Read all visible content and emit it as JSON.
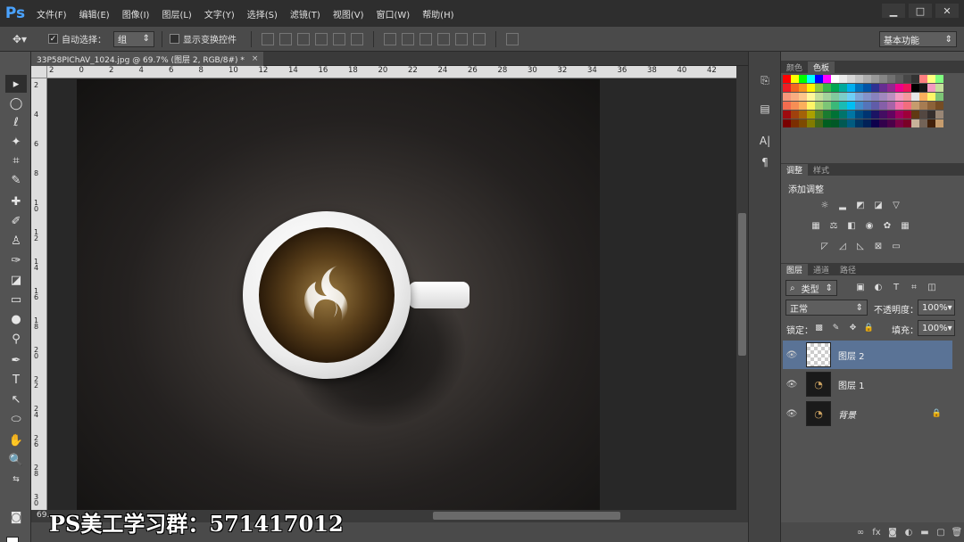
{
  "app": {
    "logo": "Ps"
  },
  "menu": [
    "文件(F)",
    "编辑(E)",
    "图像(I)",
    "图层(L)",
    "文字(Y)",
    "选择(S)",
    "滤镜(T)",
    "视图(V)",
    "窗口(W)",
    "帮助(H)"
  ],
  "window_buttons": {
    "minimize": "▁",
    "maximize": "□",
    "close": "✕"
  },
  "options": {
    "auto_select_label": "自动选择：",
    "auto_select_checked": "✓",
    "auto_select_value": "组",
    "transform_label": "显示变换控件",
    "workspace": "基本功能"
  },
  "document": {
    "tab_title": "33P58PIChAV_1024.jpg @ 69.7% (图层 2, RGB/8#) *",
    "tab_close": "×",
    "status_text": "69.",
    "watermark": "PS美工学习群：571417012"
  },
  "ruler": {
    "h": [
      "2",
      "0",
      "2",
      "4",
      "6",
      "8",
      "10",
      "12",
      "14",
      "16",
      "18",
      "20",
      "22",
      "24",
      "26",
      "28",
      "30",
      "32",
      "34",
      "36",
      "38",
      "40",
      "42"
    ],
    "v": [
      "2",
      "4",
      "6",
      "8",
      "10",
      "12",
      "14",
      "16",
      "18",
      "20",
      "22",
      "24",
      "26",
      "28",
      "30"
    ]
  },
  "panels": {
    "color_tabs": [
      "颜色",
      "色板"
    ],
    "adj_tabs": [
      "调整",
      "样式"
    ],
    "adj_title": "添加调整",
    "layers_tabs": [
      "图层",
      "通道",
      "路径"
    ],
    "kind_label": "类型",
    "blend_mode": "正常",
    "opacity_label": "不透明度：",
    "opacity_value": "100%",
    "lock_label": "锁定：",
    "fill_label": "填充：",
    "fill_value": "100%",
    "layers": [
      {
        "name": "图层 2",
        "selected": true
      },
      {
        "name": "图层 1",
        "selected": false
      },
      {
        "name": "背景",
        "selected": false
      }
    ]
  },
  "colors": {
    "accent": "#4aa3ff",
    "selection": "#5a7396"
  },
  "swatches": [
    [
      "#ff0000",
      "#ffff00",
      "#00ff00",
      "#00ffff",
      "#0000ff",
      "#ff00ff",
      "#ffffff",
      "#ebebeb",
      "#d6d6d6",
      "#c2c2c2",
      "#adadad",
      "#999999",
      "#858585",
      "#707070",
      "#5c5c5c",
      "#474747",
      "#333333",
      "#ff8080",
      "#ffff80",
      "#80ff80"
    ],
    [
      "#ee1d24",
      "#f26522",
      "#f7941d",
      "#fff200",
      "#8dc63f",
      "#39b54a",
      "#00a651",
      "#00a99d",
      "#00aeef",
      "#0072bc",
      "#0054a6",
      "#2e3192",
      "#662d91",
      "#92278f",
      "#ec008c",
      "#ed145b",
      "#000000",
      "#1a1a1a",
      "#f49ac1",
      "#c4df9b"
    ],
    [
      "#f7977a",
      "#f9ad81",
      "#fdc68a",
      "#fff79a",
      "#c4df9b",
      "#a3d39c",
      "#82ca9d",
      "#7bcdc8",
      "#6ecff6",
      "#7ea7d8",
      "#8493ca",
      "#8882be",
      "#a187be",
      "#bc8dbf",
      "#f49ac1",
      "#f5989d",
      "#e6e6e6",
      "#fbaf5d",
      "#fff568",
      "#7cc576"
    ],
    [
      "#f26c4f",
      "#f68e55",
      "#fbaf5c",
      "#fff467",
      "#acd372",
      "#7cc576",
      "#3bb878",
      "#1abbb4",
      "#00bff3",
      "#438ccb",
      "#5574b9",
      "#605ca8",
      "#855fa8",
      "#a763a8",
      "#f06ea9",
      "#f26d7d",
      "#c69c6d",
      "#a67c52",
      "#8c6239",
      "#754c24"
    ],
    [
      "#9e0b0f",
      "#a0410d",
      "#a36209",
      "#aba000",
      "#598527",
      "#1a7b30",
      "#007236",
      "#00746b",
      "#0076a3",
      "#004b80",
      "#003471",
      "#1b1464",
      "#440e62",
      "#630460",
      "#9e005d",
      "#9e0039",
      "#603913",
      "#534741",
      "#362f2d",
      "#998675"
    ],
    [
      "#790000",
      "#7b2e00",
      "#7d4900",
      "#827b00",
      "#406618",
      "#005e20",
      "#005826",
      "#005952",
      "#005b7f",
      "#003663",
      "#002157",
      "#0d004c",
      "#32004b",
      "#4b0049",
      "#7b0046",
      "#7a0026",
      "#c7b299",
      "#736357",
      "#42210b",
      "#c69c6d"
    ]
  ]
}
